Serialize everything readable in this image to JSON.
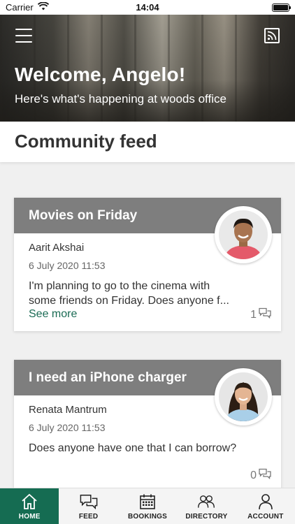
{
  "status_bar": {
    "carrier": "Carrier",
    "time": "14:04"
  },
  "hero": {
    "title": "Welcome, Angelo!",
    "subtitle": "Here's what's happening at woods office"
  },
  "section": {
    "title": "Community feed"
  },
  "posts": [
    {
      "title": "Movies on Friday",
      "author": "Aarit Akshai",
      "date": "6 July 2020 11:53",
      "message": "I'm planning to go to the cinema with some friends on Friday. Does anyone f...",
      "see_more": "See more",
      "comment_count": "1"
    },
    {
      "title": "I need an iPhone charger",
      "author": "Renata Mantrum",
      "date": "6 July 2020 11:53",
      "message": "Does anyone have one that I can borrow?",
      "comment_count": "0"
    }
  ],
  "nav": {
    "items": [
      {
        "label": "HOME",
        "icon": "home-icon"
      },
      {
        "label": "FEED",
        "icon": "chat-icon"
      },
      {
        "label": "BOOKINGS",
        "icon": "calendar-icon"
      },
      {
        "label": "DIRECTORY",
        "icon": "people-icon"
      },
      {
        "label": "ACCOUNT",
        "icon": "person-icon"
      }
    ],
    "active": "HOME"
  },
  "colors": {
    "accent": "#156c52",
    "link": "#1a6b54",
    "card_header": "#7e7e7e"
  }
}
